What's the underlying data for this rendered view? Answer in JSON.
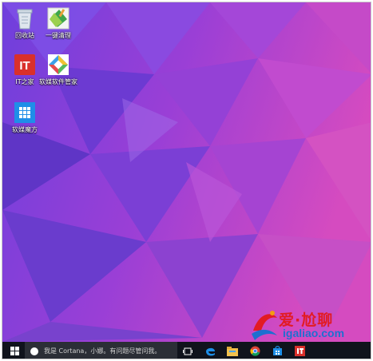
{
  "desktop": {
    "icons": [
      {
        "label": "回收站",
        "icon": "recycle-bin-icon"
      },
      {
        "label": "一键清理",
        "icon": "broom-cleaner-icon"
      },
      {
        "label": "IT之家",
        "icon": "ithome-app-icon",
        "logo_text": "IT"
      },
      {
        "label": "软媒软件管家",
        "icon": "software-manager-icon"
      },
      {
        "label": "软媒魔方",
        "icon": "rubik-cube-icon"
      }
    ]
  },
  "taskbar": {
    "search_placeholder": "我是 Cortana，小娜。有问题尽管问我。",
    "apps": [
      "start-icon",
      "microphone-icon",
      "task-view-icon",
      "edge-icon",
      "file-explorer-icon",
      "chrome-icon",
      "store-icon",
      "ithome-taskbar-icon"
    ]
  },
  "watermark": {
    "text": "爱·尬聊",
    "domain": "igaliao.com"
  },
  "colors": {
    "wallpaper_violet": "#7a3fd8",
    "wallpaper_magenta": "#e04bb8",
    "taskbar": "#10131c",
    "search_box": "#2b2e36",
    "ithome_red": "#d9302b",
    "watermark_red": "#e21b23",
    "watermark_blue": "#1e6fd0"
  }
}
